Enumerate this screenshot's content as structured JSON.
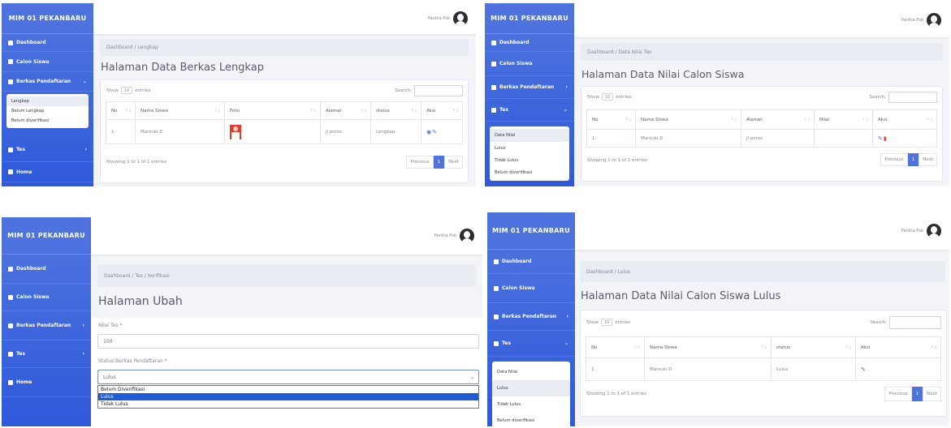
{
  "brand": "MIM 01 PEKANBARU",
  "user_name": "Panitia Psb",
  "nav": {
    "dashboard": "Dashboard",
    "calon_siswa": "Calon Siswa",
    "berkas_pendaftaran": "Berkas Pendaftaran",
    "tes": "Tes",
    "home": "Home"
  },
  "berkas_submenu": [
    "Lengkap",
    "Belum Lengkap",
    "Belum diverifikasi"
  ],
  "tes_submenu": [
    "Data Nilai",
    "Lulus",
    "Tidak Lulus",
    "Belum diverifikasi"
  ],
  "table_controls": {
    "show": "Show",
    "entries_value": "10",
    "entries": "entries",
    "search": "Search:"
  },
  "pager": {
    "previous": "Previous",
    "page": "1",
    "next": "Next",
    "info": "Showing 1 to 1 of 1 entries"
  },
  "panel1": {
    "breadcrumb": "Dashboard / Lengkap",
    "title": "Halaman Data Berkas Lengkap",
    "columns": [
      "No",
      "Nama Siswa",
      "Foto",
      "Alamat",
      "status",
      "Aksi"
    ],
    "row": {
      "no": "1",
      "nama": "Marsuki.D",
      "alamat": "jl poros",
      "status": "Lengkap"
    }
  },
  "panel2": {
    "breadcrumb": "Dashboard / Data Nilai Tes",
    "title": "Halaman Data Nilai Calon Siswa",
    "columns": [
      "No",
      "Nama Siswa",
      "Alamat",
      "Nilai",
      "Aksi"
    ],
    "row": {
      "no": "1",
      "nama": "Marsuki.D",
      "alamat": "jl poros",
      "nilai": ""
    }
  },
  "panel3": {
    "breadcrumb": "Dashboard / Tes / Verifikasi",
    "title": "Halaman Ubah",
    "nilai_label": "Nilai Tes *",
    "nilai_value": "100",
    "status_label": "Status Berkas Pendaftaran *",
    "status_value": "Lulus",
    "options": [
      "Belum Diverifikasi",
      "Lulus",
      "Tidak Lulus"
    ]
  },
  "panel4": {
    "breadcrumb": "Dashboard / Lulus",
    "title": "Halaman Data Nilai Calon Siswa Lulus",
    "columns": [
      "No",
      "Nama Siswa",
      "status",
      "Aksi"
    ],
    "row": {
      "no": "1",
      "nama": "Marsuki.D",
      "status": "Lulus"
    }
  }
}
